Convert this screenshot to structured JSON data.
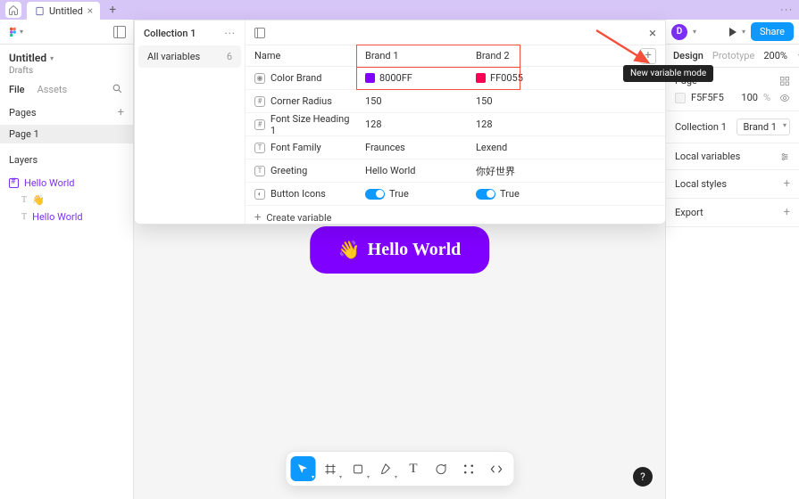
{
  "titlebar": {
    "tab_title": "Untitled"
  },
  "left_panel": {
    "project": {
      "title": "Untitled",
      "subtitle": "Drafts"
    },
    "file_tabs": {
      "file": "File",
      "assets": "Assets"
    },
    "pages": {
      "label": "Pages",
      "items": [
        "Page 1"
      ]
    },
    "layers": {
      "label": "Layers",
      "frame": "Hello World",
      "child_emoji": "👋",
      "child_text": "Hello World"
    }
  },
  "canvas": {
    "hello_button_text": "Hello World",
    "hello_emoji": "👋"
  },
  "right_panel": {
    "avatar_initial": "D",
    "share": "Share",
    "tabs": {
      "design": "Design",
      "prototype": "Prototype"
    },
    "zoom": "200%",
    "page_section": {
      "label": "Page",
      "bg_hex": "F5F5F5",
      "opacity": "100",
      "opacity_unit": "%"
    },
    "collection_row": {
      "label": "Collection 1",
      "selected": "Brand 1"
    },
    "local_variables": "Local variables",
    "local_styles": "Local styles",
    "export": "Export"
  },
  "variables_panel": {
    "collection": "Collection 1",
    "group": {
      "label": "All variables",
      "count": "6"
    },
    "columns": {
      "name": "Name",
      "brand1": "Brand 1",
      "brand2": "Brand 2"
    },
    "rows": [
      {
        "type": "color",
        "name": "Color Brand",
        "b1": "8000FF",
        "b2": "FF0055",
        "sw1": "#8000FF",
        "sw2": "#FF0055"
      },
      {
        "type": "number",
        "name": "Corner Radius",
        "b1": "150",
        "b2": "150"
      },
      {
        "type": "number",
        "name": "Font Size Heading 1",
        "b1": "128",
        "b2": "128"
      },
      {
        "type": "text",
        "name": "Font Family",
        "b1": "Fraunces",
        "b2": "Lexend"
      },
      {
        "type": "text",
        "name": "Greeting",
        "b1": "Hello World",
        "b2": "你好世界"
      },
      {
        "type": "bool",
        "name": "Button Icons",
        "b1": "True",
        "b2": "True"
      }
    ],
    "create": "Create variable"
  },
  "tooltip": "New variable mode"
}
